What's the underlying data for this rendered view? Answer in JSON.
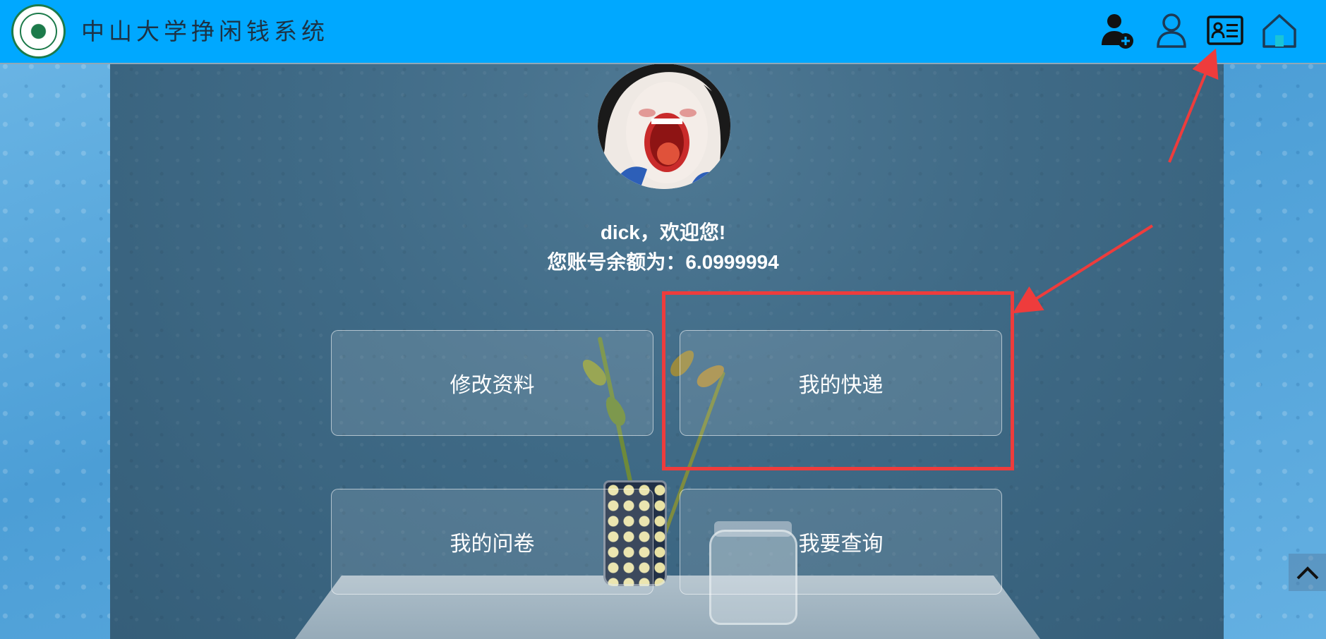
{
  "header": {
    "title": "中山大学挣闲钱系统",
    "logo_alt": "中山大学",
    "nav_icons": [
      {
        "name": "register-user-icon",
        "color": "#111111"
      },
      {
        "name": "user-icon",
        "color": "#1d3a55"
      },
      {
        "name": "id-card-icon",
        "color": "#111111"
      },
      {
        "name": "home-icon",
        "color": "#1d3a55"
      }
    ]
  },
  "profile": {
    "greeting": "dick，欢迎您!",
    "balance_label": "您账号余额为：6.0999994"
  },
  "menu": {
    "edit_profile": "修改资料",
    "my_delivery": "我的快递",
    "my_survey": "我的问卷",
    "search": "我要查询"
  },
  "colors": {
    "header_bg": "#00a8ff",
    "annotation": "#ee3c3c",
    "panel_bg": "#3f6a86"
  }
}
